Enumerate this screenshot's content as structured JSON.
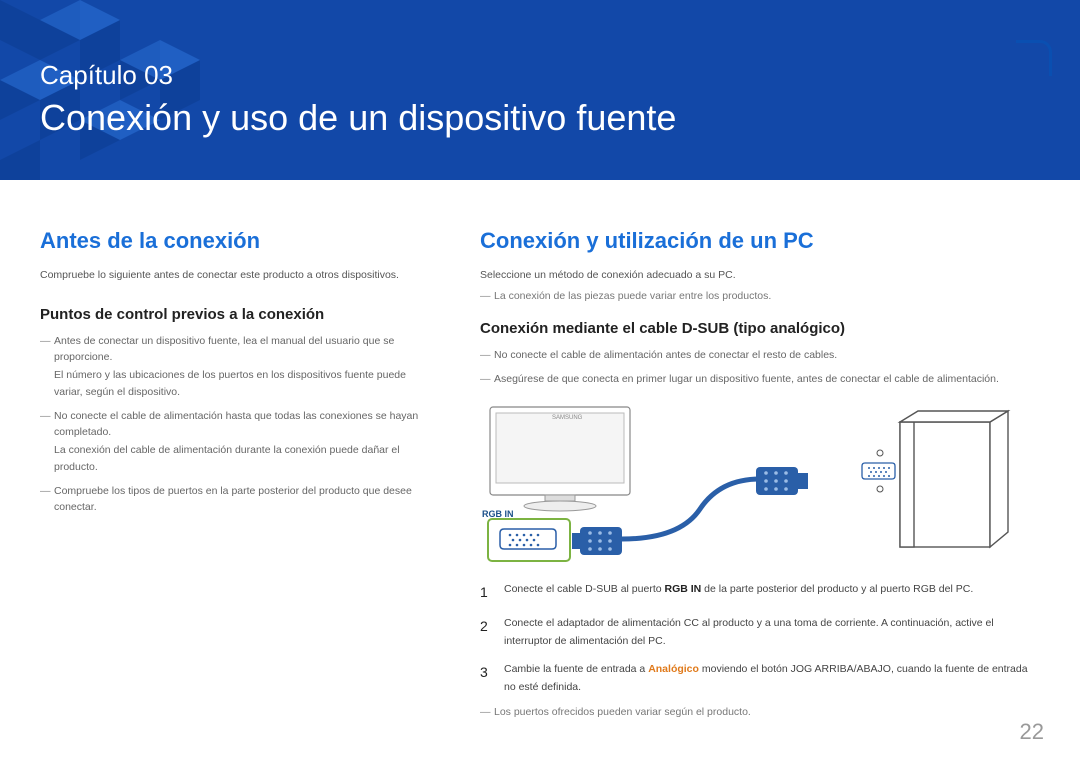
{
  "header": {
    "chapter": "Capítulo 03",
    "title": "Conexión y uso de un dispositivo fuente"
  },
  "left": {
    "heading": "Antes de la conexión",
    "intro": "Compruebe lo siguiente antes de conectar este producto a otros dispositivos.",
    "sub_heading": "Puntos de control previos a la conexión",
    "points": [
      {
        "main": "Antes de conectar un dispositivo fuente, lea el manual del usuario que se proporcione.",
        "sub": "El número y las ubicaciones de los puertos en los dispositivos fuente puede variar, según el dispositivo."
      },
      {
        "main": "No conecte el cable de alimentación hasta que todas las conexiones se hayan completado.",
        "sub": "La conexión del cable de alimentación durante la conexión puede dañar el producto."
      },
      {
        "main": "Compruebe los tipos de puertos en la parte posterior del producto que desee conectar.",
        "sub": ""
      }
    ]
  },
  "right": {
    "heading": "Conexión y utilización de un PC",
    "intro": "Seleccione un método de conexión adecuado a su PC.",
    "intro_note": "La conexión de las piezas puede variar entre los productos.",
    "sub_heading": "Conexión mediante el cable D-SUB (tipo analógico)",
    "warnings": [
      "No conecte el cable de alimentación antes de conectar el resto de cables.",
      "Asegúrese de que conecta en primer lugar un dispositivo fuente, antes de conectar el cable de alimentación."
    ],
    "rgb_label": "RGB IN",
    "steps": [
      {
        "num": "1",
        "pre": "Conecte el cable D-SUB al puerto ",
        "bold": "RGB IN",
        "post": " de la parte posterior del producto y al puerto RGB del PC."
      },
      {
        "num": "2",
        "pre": "Conecte el adaptador de alimentación CC al producto y a una toma de corriente. A continuación, active el interruptor de alimentación del PC.",
        "bold": "",
        "post": ""
      },
      {
        "num": "3",
        "pre": "Cambie la fuente de entrada a ",
        "orange": "Analógico",
        "post": " moviendo el botón JOG ARRIBA/ABAJO, cuando la fuente de entrada no esté definida."
      }
    ],
    "footer_note": "Los puertos ofrecidos pueden variar según el producto."
  },
  "page_number": "22"
}
